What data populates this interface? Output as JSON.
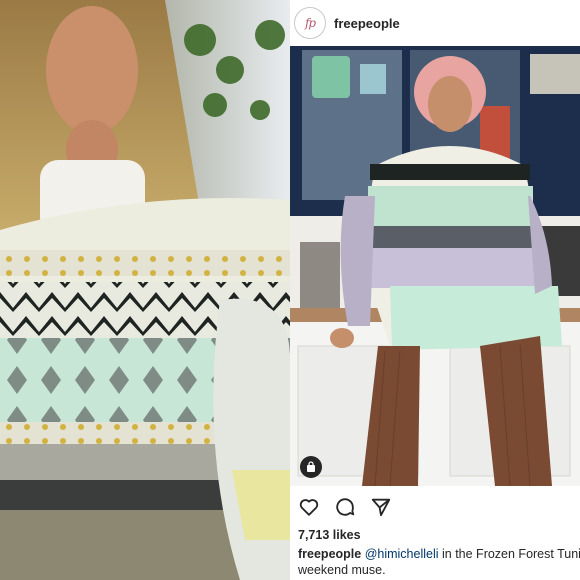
{
  "post": {
    "username": "freepeople",
    "avatar_text": "fp",
    "likes": "7,713 likes",
    "caption": {
      "username": "freepeople",
      "mention": "@himichelleli",
      "text_line1": " in the Frozen Forest Tunic",
      "text_line2": "weekend muse."
    },
    "icons": [
      "heart-icon",
      "comment-icon",
      "share-icon",
      "shopping-bag-icon"
    ]
  },
  "colors": {
    "text": "#262626",
    "mention": "#00376b",
    "cabinet_blue": "#1d2e4d",
    "sweater_mint": "#bfe3cf",
    "pants_brown": "#7a4a33"
  }
}
